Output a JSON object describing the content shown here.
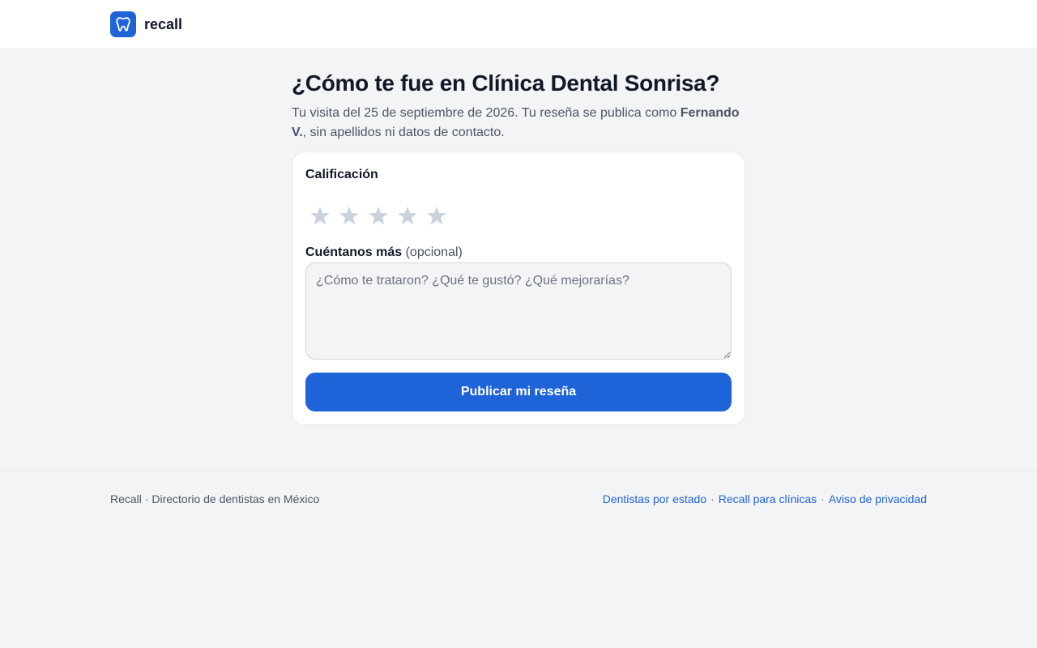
{
  "header": {
    "brand_name": "recall",
    "logo_icon": "tooth-icon",
    "accent_color": "#1f63d8"
  },
  "main": {
    "title": "¿Cómo te fue en Clínica Dental Sonrisa?",
    "subtitle_prefix": "Tu visita del 25 de septiembre de 2026. Tu reseña se publica como ",
    "subtitle_name": "Fernando V.",
    "subtitle_suffix": ", sin apellidos ni datos de contacto."
  },
  "form": {
    "rating_label": "Calificación",
    "rating_value": 0,
    "rating_max": 5,
    "star_icon": "star-icon",
    "star_color_empty": "#cbd1dc",
    "comment_label": "Cuéntanos más",
    "comment_optional": "(opcional)",
    "comment_value": "",
    "comment_placeholder": "¿Cómo te trataron? ¿Qué te gustó? ¿Qué mejorarías?",
    "submit_label": "Publicar mi reseña"
  },
  "footer": {
    "left_text": "Recall · Directorio de dentistas en México",
    "separator": "·",
    "links": [
      "Dentistas por estado",
      "Recall para clínicas",
      "Aviso de privacidad"
    ]
  }
}
